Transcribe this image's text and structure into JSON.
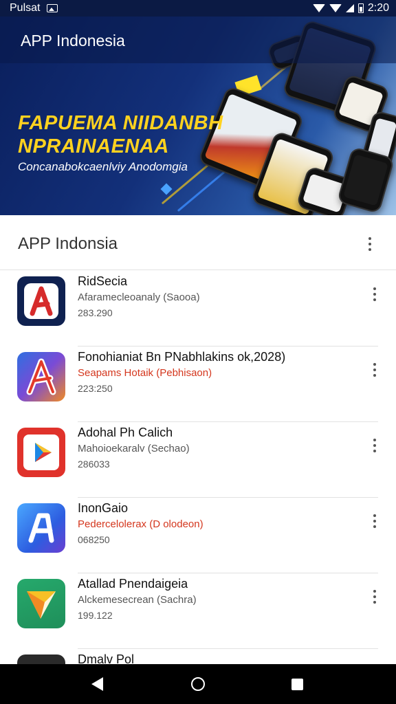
{
  "status_bar": {
    "carrier": "Pulsat",
    "time": "2:20",
    "icons": [
      "image-icon",
      "wifi-icon",
      "signal-icon",
      "battery-icon"
    ]
  },
  "banner": {
    "app_title": "APP Indonesia",
    "headline_line1": "FAPUEMA NIIDANBH",
    "headline_line2": "NPRAINAENAA",
    "subtitle": "Concanabokcaenlviy Anodomgia",
    "headline_color": "#ffd21f"
  },
  "list": {
    "title": "APP Indonsia",
    "apps": [
      {
        "name": "RidSecia",
        "subtitle": "Afaramecleoanaly (Saooa)",
        "subtitle_color": "gray",
        "count": "283.290",
        "icon": "red-a-logo-icon"
      },
      {
        "name": "Fonohianiat Bn PNabhlakins ok,2028)",
        "subtitle": "Seapams Hotaik (Pebhisaon)",
        "subtitle_color": "red",
        "count": "223:250",
        "icon": "gradient-a-logo-icon"
      },
      {
        "name": "Adohal Ph Calich",
        "subtitle": "Mahoioekaralv (Sechao)",
        "subtitle_color": "gray",
        "count": "286033",
        "icon": "play-store-icon"
      },
      {
        "name": "InonGaio",
        "subtitle": "Pedercelolerax (D olodeon)",
        "subtitle_color": "mixed",
        "count": "068250",
        "icon": "blue-a-logo-icon"
      },
      {
        "name": "Atallad Pnendaigeia",
        "subtitle": "Alckemesecrean (Sachra)",
        "subtitle_color": "gray",
        "count": "199.122",
        "icon": "arrow-logo-icon"
      },
      {
        "name": "Dmalv Pol",
        "subtitle": "",
        "subtitle_color": "gray",
        "count": "",
        "icon": "dark-app-icon"
      }
    ]
  },
  "colors": {
    "status_bar": "#0b1a44",
    "accent_red": "#d4361d",
    "nav_bar": "#000000"
  }
}
